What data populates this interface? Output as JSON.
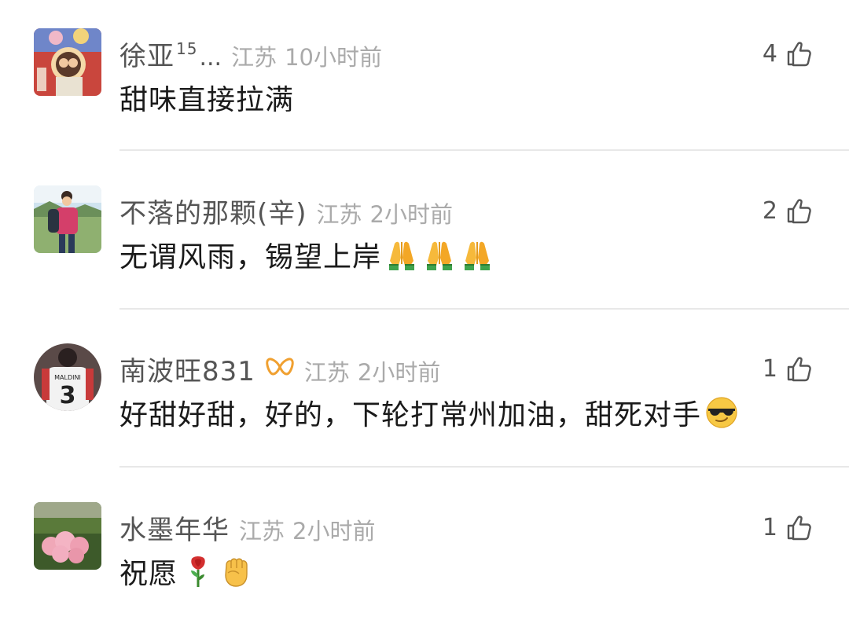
{
  "comments": [
    {
      "username": "徐亚",
      "superscript": "15",
      "ellipsis": "...",
      "location": "江苏",
      "time": "10小时前",
      "content": "甜味直接拉满",
      "likes": "4",
      "emojis": []
    },
    {
      "username": "不落的那颗(辛)",
      "location": "江苏",
      "time": "2小时前",
      "content": "无谓风雨，锡望上岸",
      "likes": "2",
      "emojis": [
        "pray-emoji",
        "pray-emoji",
        "pray-emoji"
      ]
    },
    {
      "username": "南波旺831",
      "badge": "gold-ribbon-badge-icon",
      "location": "江苏",
      "time": "2小时前",
      "content": "好甜好甜，好的，下轮打常州加油，甜死对手",
      "likes": "1",
      "emojis": [
        "sunglasses-emoji"
      ]
    },
    {
      "username": "水墨年华",
      "location": "江苏",
      "time": "2小时前",
      "content": "祝愿",
      "likes": "1",
      "emojis": [
        "rose-emoji",
        "fist-emoji"
      ]
    }
  ],
  "colors": {
    "username": "#555555",
    "meta": "#aaaaaa",
    "content": "#1a1a1a",
    "divider": "#e8e8e8",
    "badge": "#f0a030"
  }
}
